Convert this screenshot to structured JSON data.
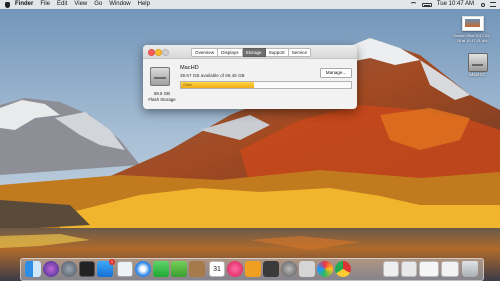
{
  "menubar": {
    "app": "Finder",
    "items": [
      "File",
      "Edit",
      "View",
      "Go",
      "Window",
      "Help"
    ],
    "clock": "Tue 10:47 AM"
  },
  "window": {
    "tabs": [
      "Overview",
      "Displays",
      "Storage",
      "Support",
      "Service"
    ],
    "active_tab": "Storage",
    "volume_name": "MacHD",
    "volume_available": "39.57 GB available of 69.46 GB",
    "usage_label": "Other",
    "usage_fraction": 0.43,
    "drive_size": "69.5 GB",
    "drive_type": "Flash Storage",
    "manage_label": "Manage..."
  },
  "desktop": {
    "screenshot_label": "Screen Shot 2017-09-26 at 10.47.01 AM",
    "drive_label": "MacHD"
  },
  "dock": {
    "app_store_badge": "1",
    "calendar_day": "31"
  },
  "colors": {
    "usage_fill": "#f1ad16",
    "close": "#fc5f57",
    "minimize": "#fdbc2e"
  }
}
